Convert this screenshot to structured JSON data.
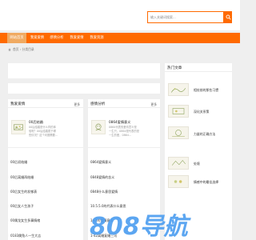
{
  "search": {
    "placeholder": "输入关键词搜索..."
  },
  "nav": {
    "items": [
      "网站首页",
      "我爱爱情",
      "感情分析",
      "我爱爱情",
      "我爱资源"
    ]
  },
  "breadcrumb": {
    "text": "首页 › 分类目录"
  },
  "section1": {
    "title": "我爱爱情",
    "more": "更多",
    "featured": {
      "title": "00后结婚",
      "desc": [
        "00后结婚是什么样的体",
        "验呢？00后结婚属于哪",
        "些情况？这个问题需要..."
      ]
    },
    "items": [
      "00后初结婚",
      "00后离婚再结婚",
      "00后女生的发嗲表",
      "00后女人生孩子",
      "00属龙女生多事情绪",
      "0183属兔人一生大吉"
    ]
  },
  "section2": {
    "title": "感情分析",
    "more": "更多",
    "featured": {
      "title": "0864爱情意义",
      "desc": [
        "0864代表的爱情意义是",
        "一生只，0864是代表的是",
        "一生的爱，0864..."
      ]
    },
    "items": [
      "0864爱情意义",
      "0848爱情的含义",
      "0848什么意思爱情",
      "10.5.5.0的代表什么意思",
      "1+1的爱情意义",
      "1-42离婚复婚三讯"
    ]
  },
  "sidebar": {
    "title": "热门文章",
    "items": [
      "相处前的那些习惯",
      "深化关系策",
      "力量的正确方法",
      "处境",
      "情感中的最佳选择"
    ]
  },
  "watermark": {
    "text": "808导航"
  },
  "colors": {
    "accent": "#ff6a00",
    "nav_active": "#f0aa62",
    "watermark": "#4a9cf0"
  }
}
